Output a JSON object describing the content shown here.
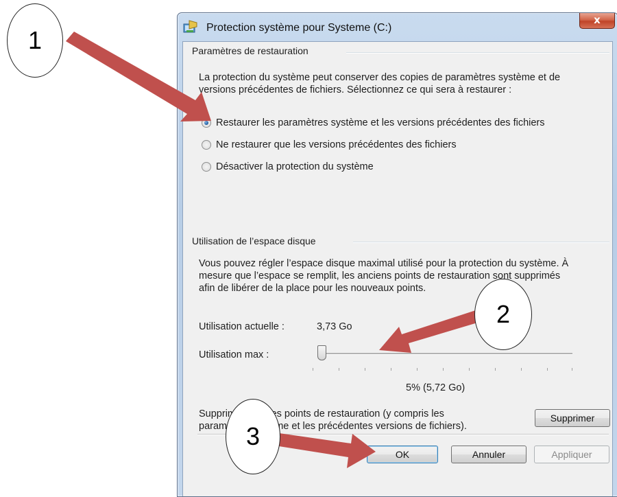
{
  "window": {
    "title": "Protection système pour Systeme (C:)",
    "close_label": "x"
  },
  "restore": {
    "group_title": "Paramètres de restauration",
    "description_line1": "La protection du système peut conserver des copies de paramètres système et de",
    "description_line2": "versions précédentes de fichiers. Sélectionnez ce qui sera à restaurer :",
    "options": [
      {
        "label": "Restaurer les paramètres système et les versions précédentes des fichiers",
        "checked": true
      },
      {
        "label": "Ne restaurer que les versions précédentes des fichiers",
        "checked": false
      },
      {
        "label": "Désactiver la protection du système",
        "checked": false
      }
    ]
  },
  "disk": {
    "group_title": "Utilisation de l’espace disque",
    "description_line1": "Vous pouvez régler l’espace disque maximal utilisé pour la protection du système. À",
    "description_line2": "mesure que l’espace se remplit, les anciens points de restauration sont supprimés",
    "description_line3": "afin de libérer de la place pour les nouveaux points.",
    "current_label": "Utilisation actuelle :",
    "current_value": "3,73 Go",
    "max_label": "Utilisation max :",
    "max_value_text": "5% (5,72 Go)",
    "max_percent": 5,
    "delete_text_line1": "Supprimer tous les points de restauration (y compris les",
    "delete_text_line2": "paramètres système et les précédentes versions de fichiers).",
    "delete_button": "Supprimer"
  },
  "footer": {
    "ok": "OK",
    "cancel": "Annuler",
    "apply": "Appliquer"
  },
  "annotations": {
    "callouts": [
      "1",
      "2",
      "3"
    ],
    "arrow_color": "#c0504d"
  }
}
